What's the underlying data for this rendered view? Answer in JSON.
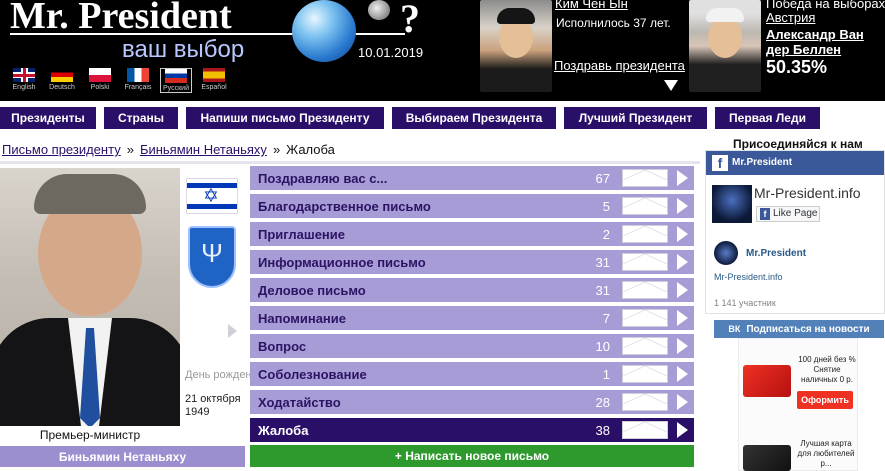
{
  "header": {
    "logo_title": "Mr. President",
    "logo_subtitle": "ваш выбор",
    "date": "10.01.2019",
    "question_mark": "?",
    "languages": [
      {
        "label": "English",
        "flag": "flag-uk-icon"
      },
      {
        "label": "Deutsch",
        "flag": "flag-germany-icon"
      },
      {
        "label": "Polski",
        "flag": "flag-poland-icon"
      },
      {
        "label": "Français",
        "flag": "flag-france-icon"
      },
      {
        "label": "Русский",
        "flag": "flag-russia-icon",
        "active": true
      },
      {
        "label": "Español",
        "flag": "flag-spain-icon"
      }
    ],
    "birthday": {
      "name": "Ким Чен Ын",
      "text": "Исполнилось 37 лет.",
      "link": "Поздравь президента"
    },
    "election": {
      "title": "Победа на выборах",
      "country": "Австрия",
      "name": "Александр Ван дер Беллен",
      "percent": "50.35%"
    }
  },
  "nav": {
    "items": [
      "Президенты",
      "Страны",
      "Напиши письмо Президенту",
      "Выбираем Президента",
      "Лучший Президент",
      "Первая Леди"
    ]
  },
  "breadcrumb": {
    "items": [
      "Письмо президенту",
      "Биньямин Нетаньяху",
      "Жалоба"
    ],
    "separator": "»"
  },
  "president": {
    "position": "Премьер-министр",
    "name": "Биньямин Нетаньяху",
    "birth_label": "День рождения",
    "birth_date": "21 октября 1949"
  },
  "letters": [
    {
      "label": "Поздравляю вас с...",
      "count": "67"
    },
    {
      "label": "Благодарственное письмо",
      "count": "5"
    },
    {
      "label": "Приглашение",
      "count": "2"
    },
    {
      "label": "Информационное письмо",
      "count": "31"
    },
    {
      "label": "Деловое письмо",
      "count": "31"
    },
    {
      "label": "Напоминание",
      "count": "7"
    },
    {
      "label": "Вопрос",
      "count": "10"
    },
    {
      "label": "Соболезнование",
      "count": "1"
    },
    {
      "label": "Ходатайство",
      "count": "28"
    },
    {
      "label": "Жалоба",
      "count": "38",
      "active": true
    }
  ],
  "write_button": "+ Написать новое письмо",
  "sidebar": {
    "join_title": "Присоединяйся к нам",
    "facebook": {
      "header": "Mr.President",
      "page_name": "Mr-President.info",
      "like": "Like Page"
    },
    "vk": {
      "name": "Mr.President",
      "site": "Mr-President.info",
      "members": "1 141 участник",
      "subscribe": "Подписаться на новости",
      "logo": "ВК"
    },
    "ad": {
      "text1": "100 дней без % Снятие наличных 0 р.",
      "button": "Оформить",
      "text2": "Лучшая карта для любителей р..."
    }
  },
  "colors": {
    "nav_bg": "#2a0f68",
    "row_bg": "#a79cd6",
    "row_active_bg": "#2a0f68",
    "write_bg": "#2e9a2e",
    "fb_blue": "#3b5998",
    "vk_blue": "#5181b8"
  }
}
